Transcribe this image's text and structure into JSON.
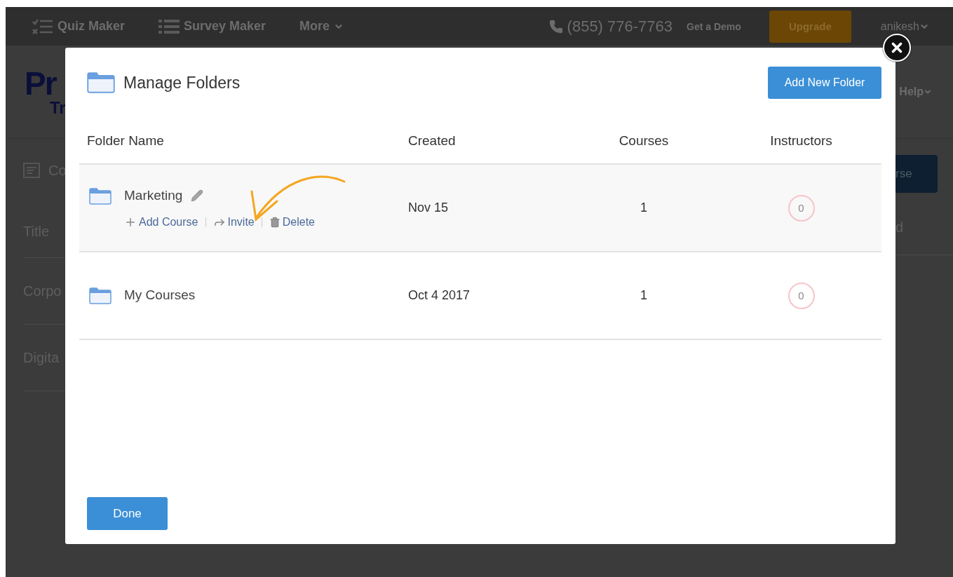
{
  "nav": {
    "items": [
      {
        "kind": "quiz",
        "label": "Quiz Maker"
      },
      {
        "kind": "survey",
        "label": "Survey Maker"
      },
      {
        "kind": "menu",
        "label": "More"
      }
    ],
    "phone": "(855) 776-7763",
    "demo": "Get a Demo",
    "upgrade": "Upgrade",
    "user": "anikesh"
  },
  "background": {
    "logo_lines": [
      "Pr",
      "Tr"
    ],
    "help": "Help",
    "section": "Co",
    "column_header": "Title",
    "rows": [
      "Corpo",
      "Digita"
    ],
    "button": "rse",
    "column_right": "d"
  },
  "modal": {
    "title": "Manage Folders",
    "add_button": "Add New Folder",
    "columns": [
      "Folder Name",
      "Created",
      "Courses",
      "Instructors"
    ],
    "folders": [
      {
        "name": "Marketing",
        "created": "Nov 15",
        "courses": "1",
        "instructors": "0",
        "selected": true,
        "actions": [
          {
            "kind": "add",
            "label": "Add Course"
          },
          {
            "kind": "invite",
            "label": "Invite"
          },
          {
            "kind": "delete",
            "label": "Delete"
          }
        ]
      },
      {
        "name": "My Courses",
        "created": "Oct 4 2017",
        "courses": "1",
        "instructors": "0",
        "selected": false
      }
    ],
    "done": "Done"
  }
}
